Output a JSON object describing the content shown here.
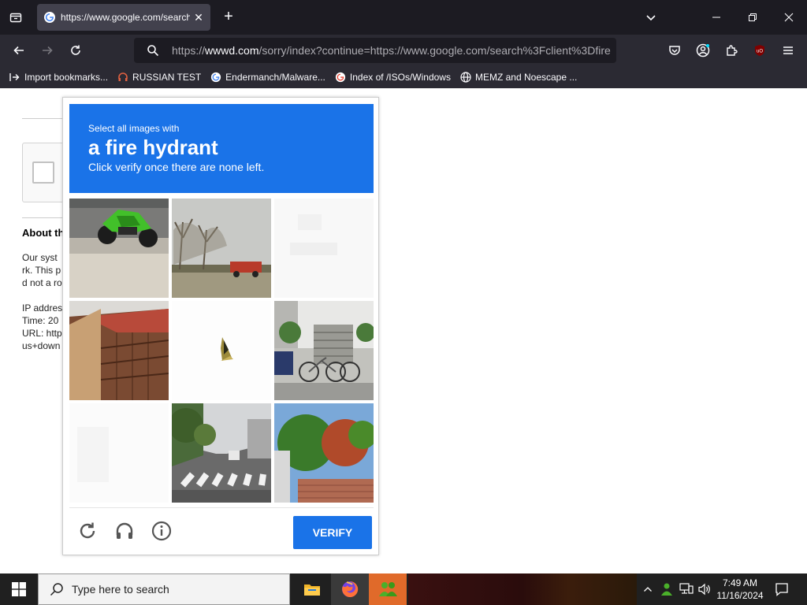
{
  "browser": {
    "tab_title": "https://www.google.com/search",
    "url_prefix": "https://",
    "url_domain": "wwwd.com",
    "url_rest": "/sorry/index?continue=https://www.google.com/search%3Fclient%3Dfire",
    "bookmarks": [
      {
        "label": "Import bookmarks...",
        "icon": "import-icon"
      },
      {
        "label": "RUSSIAN TEST",
        "icon": "headphones-icon"
      },
      {
        "label": "Endermanch/Malware...",
        "icon": "google-icon"
      },
      {
        "label": "Index of /ISOs/Windows",
        "icon": "google-icon"
      },
      {
        "label": "MEMZ and Noescape ...",
        "icon": "globe-icon"
      }
    ]
  },
  "page": {
    "about_heading": "About th",
    "text_lines": [
      "Our syst",
      "rk. This p",
      "d not a ro",
      "IP addres",
      "Time: 20",
      "URL: http",
      "us+down"
    ]
  },
  "captcha": {
    "instruction_small": "Select all images with",
    "target": "a fire hydrant",
    "instruction_sub": "Click verify once there are none left.",
    "verify_label": "VERIFY"
  },
  "taskbar": {
    "search_placeholder": "Type here to search",
    "time": "7:49 AM",
    "date": "11/16/2024"
  },
  "colors": {
    "accent": "#1a73e8",
    "chrome_dark": "#1c1b22",
    "chrome_mid": "#2b2a33"
  }
}
